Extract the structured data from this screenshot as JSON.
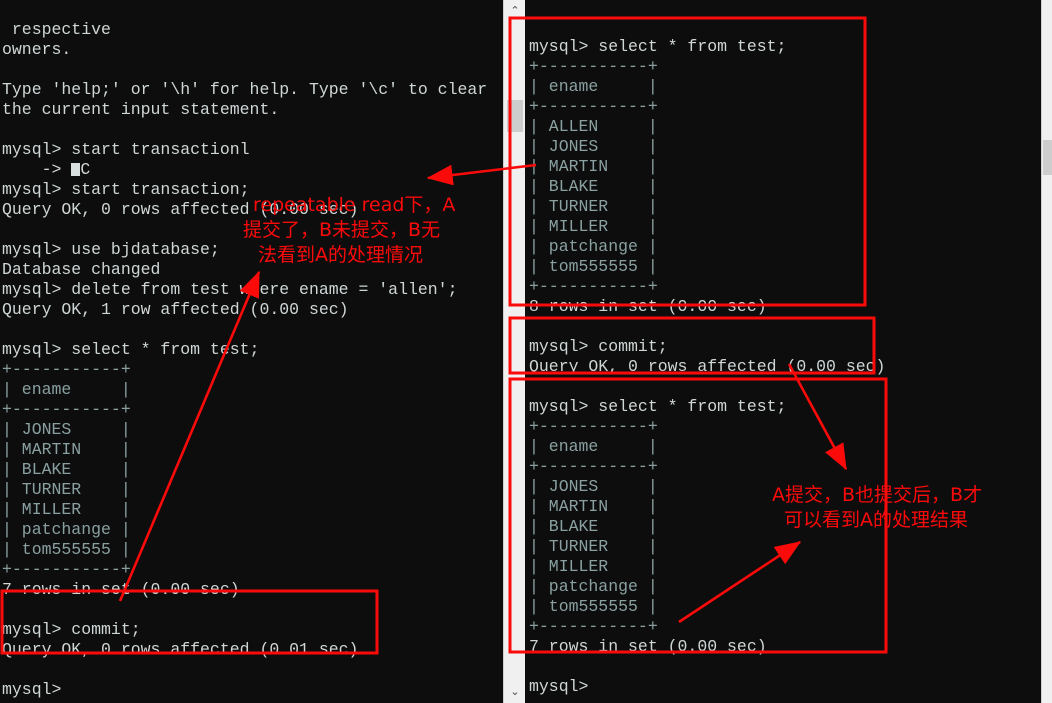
{
  "app": {
    "kind": "mysql-client-terminals",
    "colors": {
      "terminal_bg": "#0d0d0d",
      "terminal_fg": "#cfd6d6",
      "annotation_red": "#fb0a0a",
      "scrollbar_track": "#f0f0f0",
      "scrollbar_thumb": "#cdcdcd"
    }
  },
  "left_terminal": {
    "name": "session-A-terminal",
    "lines": [
      " respective",
      "owners.",
      "",
      "Type 'help;' or '\\h' for help. Type '\\c' to clear",
      "the current input statement.",
      "",
      "mysql> start transactionl",
      "    -> ^C",
      "mysql> start transaction;",
      "Query OK, 0 rows affected (0.00 sec)",
      "",
      "mysql> use bjdatabase;",
      "Database changed",
      "mysql> delete from test where ename = 'allen';",
      "Query OK, 1 row affected (0.00 sec)",
      "",
      "mysql> select * from test;",
      "+-----------+",
      "| ename     |",
      "+-----------+",
      "| JONES     |",
      "| MARTIN    |",
      "| BLAKE     |",
      "| TURNER    |",
      "| MILLER    |",
      "| patchange |",
      "| tom555555 |",
      "+-----------+",
      "7 rows in set (0.00 sec)",
      "",
      "mysql> commit;",
      "Query OK, 0 rows affected (0.01 sec)",
      "",
      "mysql>"
    ],
    "result_table": {
      "columns": [
        "ename"
      ],
      "rows": [
        "JONES",
        "MARTIN",
        "BLAKE",
        "TURNER",
        "MILLER",
        "patchange",
        "tom555555"
      ],
      "row_count_text": "7 rows in set (0.00 sec)"
    },
    "commands": [
      "start transactionl",
      "start transaction;",
      "use bjdatabase;",
      "delete from test where ename = 'allen';",
      "select * from test;",
      "commit;"
    ],
    "prompt": "mysql>"
  },
  "right_terminal": {
    "name": "session-B-terminal",
    "lines": [
      "mysql> select * from test;",
      "+-----------+",
      "| ename     |",
      "+-----------+",
      "| ALLEN     |",
      "| JONES     |",
      "| MARTIN    |",
      "| BLAKE     |",
      "| TURNER    |",
      "| MILLER    |",
      "| patchange |",
      "| tom555555 |",
      "+-----------+",
      "8 rows in set (0.00 sec)",
      "",
      "mysql> commit;",
      "Query OK, 0 rows affected (0.00 sec)",
      "",
      "mysql> select * from test;",
      "+-----------+",
      "| ename     |",
      "+-----------+",
      "| JONES     |",
      "| MARTIN    |",
      "| BLAKE     |",
      "| TURNER    |",
      "| MILLER    |",
      "| patchange |",
      "| tom555555 |",
      "+-----------+",
      "7 rows in set (0.00 sec)",
      "",
      "mysql>"
    ],
    "first_result_table": {
      "columns": [
        "ename"
      ],
      "rows": [
        "ALLEN",
        "JONES",
        "MARTIN",
        "BLAKE",
        "TURNER",
        "MILLER",
        "patchange",
        "tom555555"
      ],
      "row_count_text": "8 rows in set (0.00 sec)"
    },
    "second_result_table": {
      "columns": [
        "ename"
      ],
      "rows": [
        "JONES",
        "MARTIN",
        "BLAKE",
        "TURNER",
        "MILLER",
        "patchange",
        "tom555555"
      ],
      "row_count_text": "7 rows in set (0.00 sec)"
    },
    "commands": [
      "select * from test;",
      "commit;",
      "select * from test;"
    ],
    "prompt": "mysql>"
  },
  "annotations": {
    "note_left": {
      "line1": "repeatable read下，A",
      "line2": "提交了，B未提交，B无",
      "line3": "法看到A的处理情况"
    },
    "note_right": {
      "line1": "A提交，B也提交后，B才",
      "line2": "可以看到A的处理结果"
    }
  },
  "scrollbars": {
    "left": {
      "up_glyph": "⌃",
      "down_glyph": "⌄"
    },
    "right": {
      "up_glyph": "",
      "down_glyph": ""
    }
  }
}
